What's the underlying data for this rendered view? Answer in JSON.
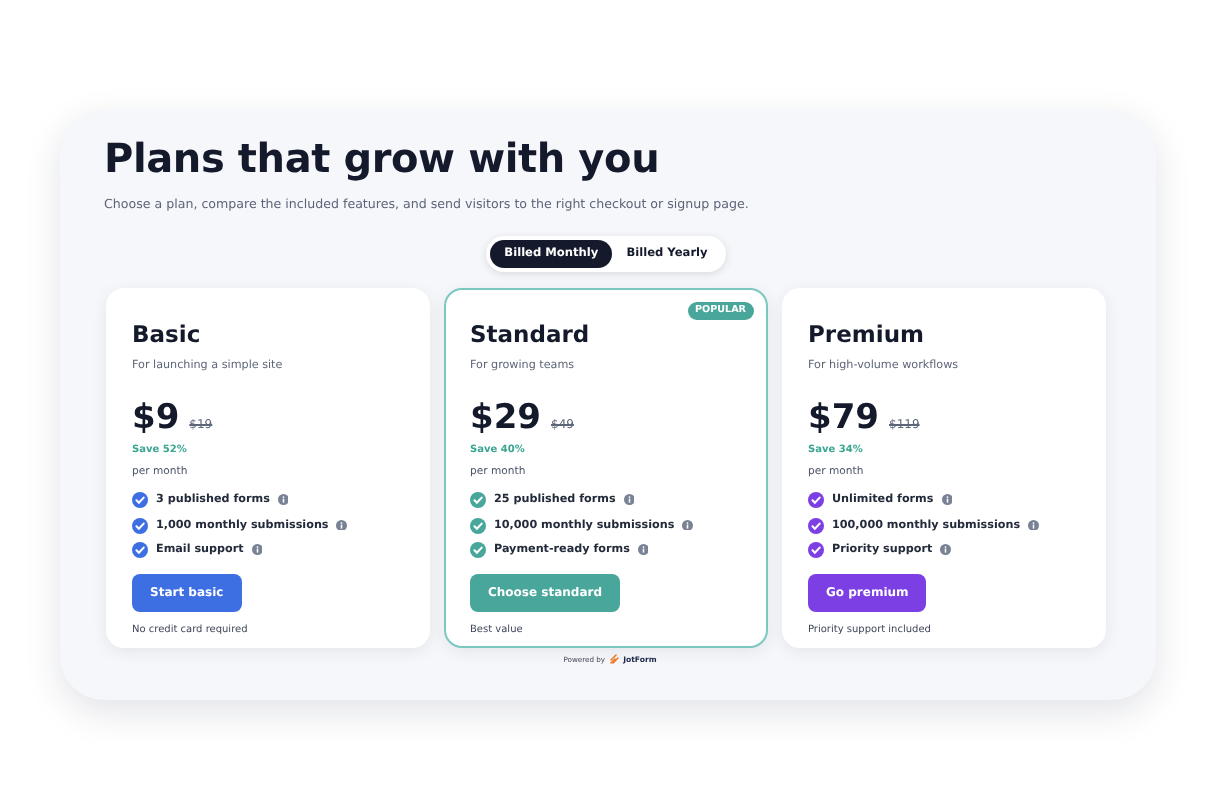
{
  "title": "Plans that grow with you",
  "subtitle": "Choose a plan, compare the included features, and send visitors to the right checkout or signup page.",
  "billing": [
    {
      "label": "Billed Monthly",
      "selected": true
    },
    {
      "label": "Billed Yearly",
      "selected": false
    }
  ],
  "plans": [
    {
      "name": "Basic",
      "tagline": "For launching a simple site",
      "price": "$9",
      "old_price": "$19",
      "save": "Save 52%",
      "period": "per month",
      "color": "#3d6fe3",
      "highlighted": false,
      "features": [
        "3 published forms",
        "1,000 monthly submissions",
        "Email support"
      ],
      "button": "Start basic",
      "note": "No credit card required"
    },
    {
      "name": "Standard",
      "badge": "POPULAR",
      "tagline": "For growing teams",
      "price": "$29",
      "old_price": "$49",
      "save": "Save 40%",
      "period": "per month",
      "color": "#48a69a",
      "highlighted": true,
      "features": [
        "25 published forms",
        "10,000 monthly submissions",
        "Payment-ready forms"
      ],
      "button": "Choose standard",
      "note": "Best value"
    },
    {
      "name": "Premium",
      "tagline": "For high-volume workflows",
      "price": "$79",
      "old_price": "$119",
      "save": "Save 34%",
      "period": "per month",
      "color": "#7b3fe4",
      "highlighted": false,
      "features": [
        "Unlimited forms",
        "100,000 monthly submissions",
        "Priority support"
      ],
      "button": "Go premium",
      "note": "Priority support included"
    }
  ],
  "footer": {
    "prefix": "Powered by",
    "brand": "JotForm"
  }
}
